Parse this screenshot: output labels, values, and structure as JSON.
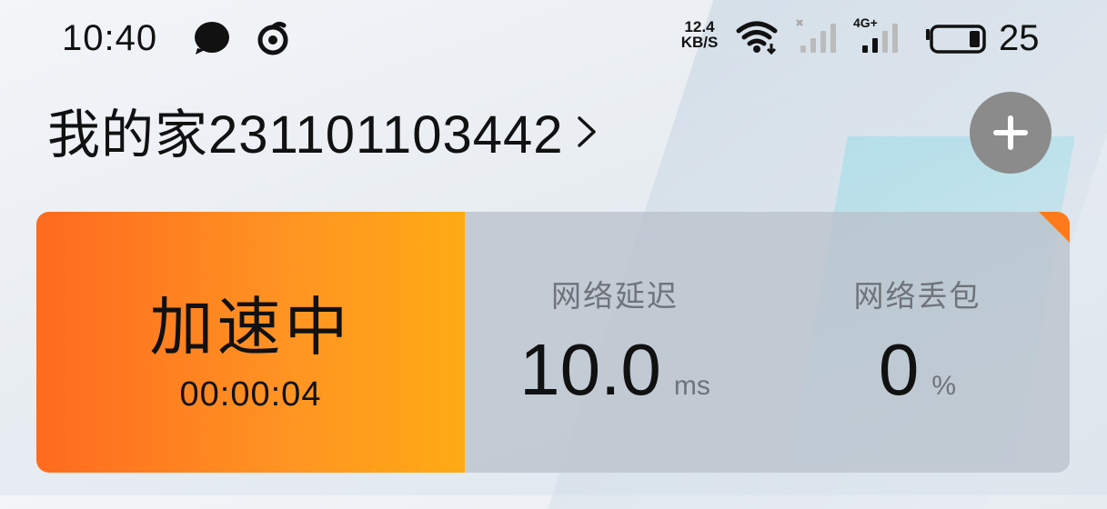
{
  "status_bar": {
    "time": "10:40",
    "net_speed_value": "12.4",
    "net_speed_unit": "KB/S",
    "signal2_tag": "4G+",
    "battery_level": "25",
    "icons": [
      "chat-bubble-icon",
      "swirl-app-icon",
      "wifi-icon",
      "signal-sim1-icon",
      "signal-sim2-icon",
      "battery-icon"
    ]
  },
  "header": {
    "title": "我的家231101103442",
    "add_button_icon": "plus-icon"
  },
  "card": {
    "accel_label": "加速中",
    "accel_timer": "00:00:04",
    "latency": {
      "label": "网络延迟",
      "value": "10.0",
      "unit": "ms"
    },
    "packet_loss": {
      "label": "网络丢包",
      "value": "0",
      "unit": "%"
    }
  },
  "colors": {
    "accent_start": "#ff6a1f",
    "accent_end": "#ffaa14",
    "add_button": "#8b8b8b",
    "card_panel": "#bac2cc"
  }
}
